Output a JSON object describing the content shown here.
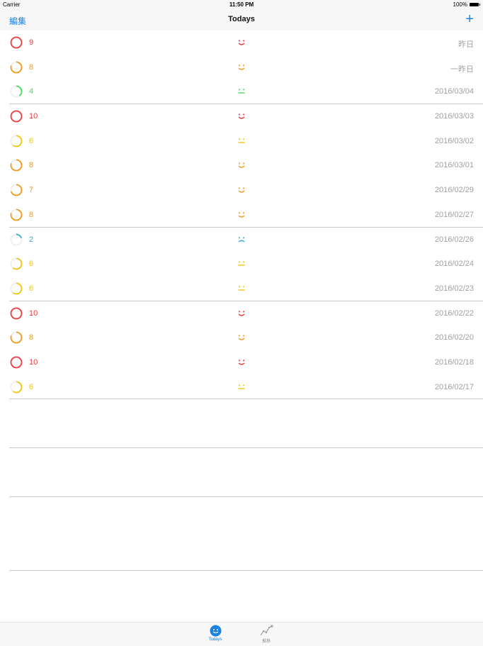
{
  "status": {
    "carrier": "Carrier",
    "time": "11:50 PM",
    "battery": "100%"
  },
  "nav": {
    "edit": "編集",
    "title": "Todays",
    "add": "+"
  },
  "colors": {
    "accent": "#1a82e5",
    "red": "#ea3d3d",
    "orange": "#f39a1c",
    "yellow": "#f2c40f",
    "green": "#4cd964",
    "blue": "#34aadc",
    "date": "#a0a0a0"
  },
  "rows": [
    {
      "score": "9",
      "level": 1.0,
      "color": "#ea3d3d",
      "face": "smile",
      "date": "昨日"
    },
    {
      "score": "8",
      "level": 0.8,
      "color": "#f39a1c",
      "face": "smile",
      "date": "一昨日"
    },
    {
      "score": "4",
      "level": 0.4,
      "color": "#4cd964",
      "face": "neutral",
      "date": "2016/03/04"
    },
    {
      "score": "10",
      "level": 1.0,
      "color": "#ea3d3d",
      "face": "smile",
      "date": "2016/03/03"
    },
    {
      "score": "6",
      "level": 0.6,
      "color": "#f2c40f",
      "face": "neutral",
      "date": "2016/03/02"
    },
    {
      "score": "8",
      "level": 0.8,
      "color": "#f39a1c",
      "face": "smile",
      "date": "2016/03/01"
    },
    {
      "score": "7",
      "level": 0.7,
      "color": "#f39a1c",
      "face": "smile",
      "date": "2016/02/29"
    },
    {
      "score": "8",
      "level": 0.8,
      "color": "#f39a1c",
      "face": "smile",
      "date": "2016/02/27"
    },
    {
      "score": "2",
      "level": 0.2,
      "color": "#34aadc",
      "face": "sad",
      "date": "2016/02/26"
    },
    {
      "score": "6",
      "level": 0.6,
      "color": "#f2c40f",
      "face": "neutral",
      "date": "2016/02/24"
    },
    {
      "score": "6",
      "level": 0.6,
      "color": "#f2c40f",
      "face": "neutral",
      "date": "2016/02/23"
    },
    {
      "score": "10",
      "level": 1.0,
      "color": "#ea3d3d",
      "face": "smile",
      "date": "2016/02/22"
    },
    {
      "score": "8",
      "level": 0.8,
      "color": "#f39a1c",
      "face": "smile",
      "date": "2016/02/20"
    },
    {
      "score": "10",
      "level": 1.0,
      "color": "#ea3d3d",
      "face": "smile",
      "date": "2016/02/18"
    },
    {
      "score": "6",
      "level": 0.6,
      "color": "#f2c40f",
      "face": "neutral",
      "date": "2016/02/17"
    }
  ],
  "tabs": [
    {
      "label": "Todays",
      "icon": "smiley-icon",
      "active": true
    },
    {
      "label": "推移",
      "icon": "chart-line-icon",
      "active": false
    }
  ]
}
